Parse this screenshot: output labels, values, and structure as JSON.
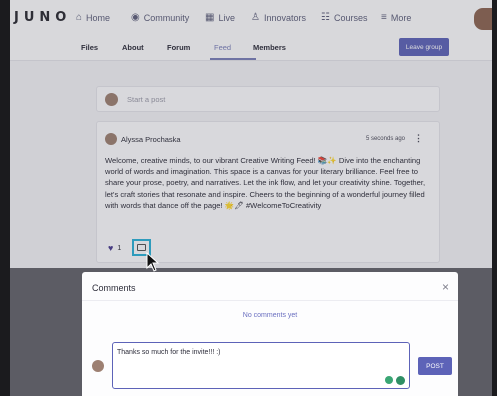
{
  "app": {
    "logo": "JUNO"
  },
  "topnav": {
    "items": [
      {
        "label": "Home",
        "icon": "home-icon"
      },
      {
        "label": "Community",
        "icon": "community-icon"
      },
      {
        "label": "Live",
        "icon": "calendar-icon"
      },
      {
        "label": "Innovators",
        "icon": "innovators-icon"
      },
      {
        "label": "Courses",
        "icon": "courses-icon"
      },
      {
        "label": "More",
        "icon": "menu-icon"
      }
    ]
  },
  "subnav": {
    "tabs": [
      {
        "label": "Files"
      },
      {
        "label": "About"
      },
      {
        "label": "Forum"
      },
      {
        "label": "Feed"
      },
      {
        "label": "Members"
      }
    ],
    "active": "Feed",
    "leave_label": "Leave group"
  },
  "composer": {
    "placeholder": "Start a post"
  },
  "post": {
    "author": "Alyssa Prochaska",
    "time": "5 seconds ago",
    "body": "Welcome, creative minds, to our vibrant Creative Writing Feed! 📚✨ Dive into the enchanting world of words and imagination. This space is a canvas for your literary brilliance. Feel free to share your prose, poetry, and narratives. Let the ink flow, and let your creativity shine. Together, let's craft stories that resonate and inspire. Cheers to the beginning of a wonderful journey filled with words that dance off the page! 🌟🖊 #WelcomeToCreativity",
    "like_count": "1"
  },
  "comments": {
    "title": "Comments",
    "empty_text": "No comments yet",
    "draft": "Thanks so much for the invite!!! :)",
    "post_label": "POST"
  },
  "colors": {
    "accent": "#5d63b8",
    "highlight": "#2bb0d6"
  }
}
